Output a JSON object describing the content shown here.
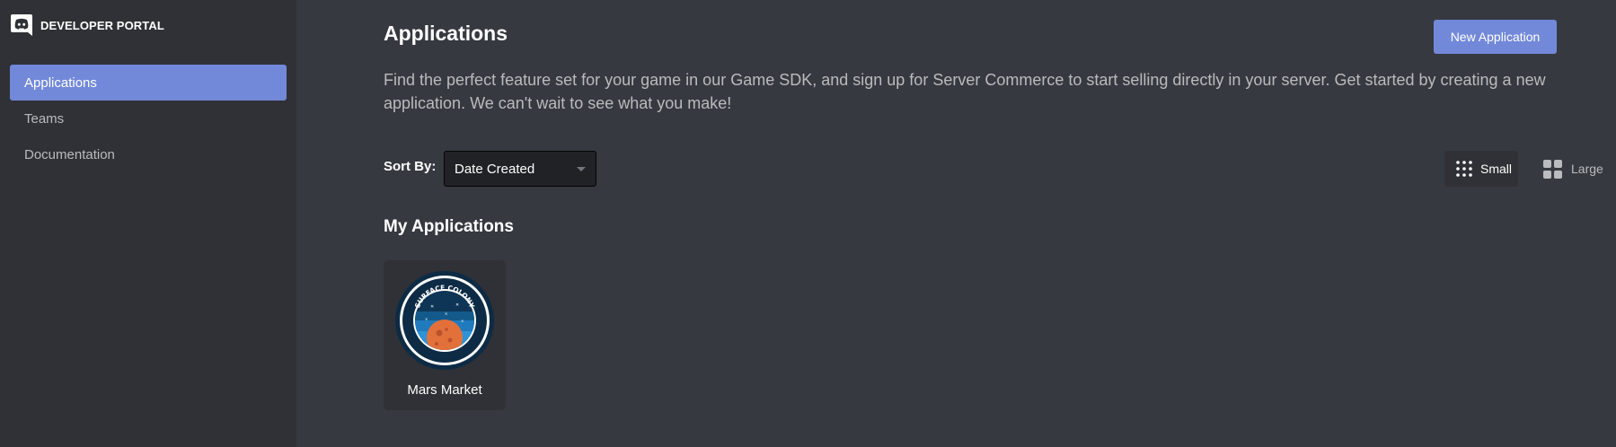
{
  "sidebar": {
    "brand": "DEVELOPER PORTAL",
    "items": [
      {
        "label": "Applications",
        "active": true
      },
      {
        "label": "Teams"
      },
      {
        "label": "Documentation"
      }
    ]
  },
  "header": {
    "title": "Applications",
    "new_button": "New Application",
    "description": "Find the perfect feature set for your game in our Game SDK, and sign up for Server Commerce to start selling directly in your server. Get started by creating a new application. We can't wait to see what you make!"
  },
  "sort": {
    "label": "Sort By:",
    "selected": "Date Created"
  },
  "view_size": {
    "small": "Small",
    "large": "Large",
    "selected": "Small"
  },
  "section": {
    "title": "My Applications"
  },
  "apps": [
    {
      "name": "Mars Market",
      "icon_text": "SURFACE COLONY",
      "icon": "planet-badge-icon"
    }
  ],
  "colors": {
    "accent": "#7289da",
    "sidebar_bg": "#2f3136",
    "main_bg": "#36393f"
  }
}
